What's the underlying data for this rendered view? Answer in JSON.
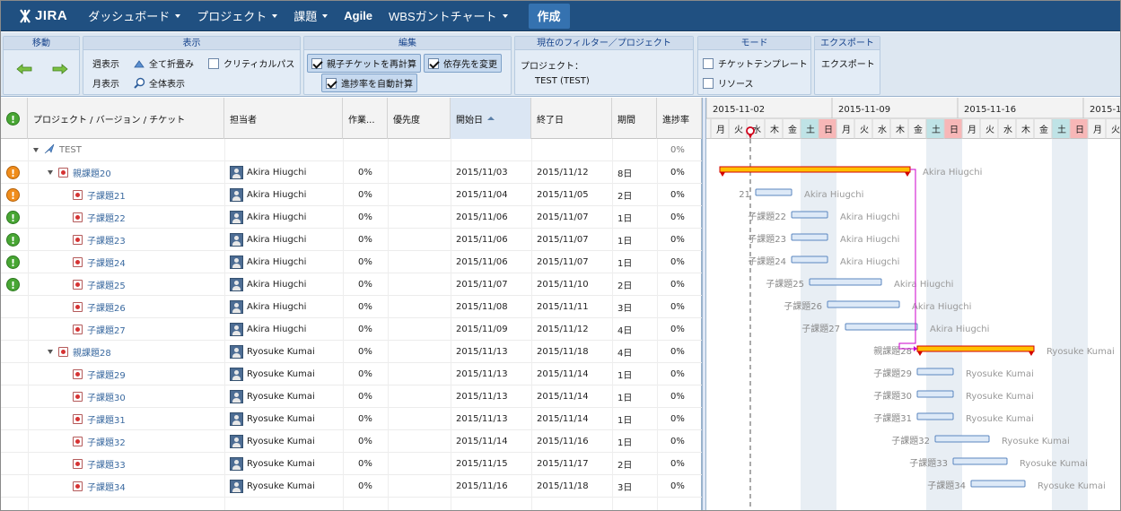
{
  "nav": {
    "logo": "JIRA",
    "items": [
      {
        "label": "ダッシュボード",
        "caret": true
      },
      {
        "label": "プロジェクト",
        "caret": true
      },
      {
        "label": "課題",
        "caret": true
      },
      {
        "label": "Agile",
        "caret": false
      },
      {
        "label": "WBSガントチャート",
        "caret": true
      }
    ],
    "create": "作成"
  },
  "toolbar": {
    "move": {
      "title": "移動"
    },
    "view": {
      "title": "表示",
      "week": "週表示",
      "month": "月表示",
      "collapse_all": "全て折畳み",
      "whole": "全体表示",
      "critical_path": "クリティカルパス"
    },
    "edit": {
      "title": "編集",
      "recalc_parent": "親子チケットを再計算",
      "change_dep": "依存先を変更",
      "auto_progress": "進捗率を自動計算"
    },
    "filter": {
      "title": "現在のフィルター／プロジェクト",
      "label": "プロジェクト：",
      "value": "TEST (TEST)"
    },
    "mode": {
      "title": "モード",
      "template": "チケットテンプレート",
      "resource": "リソース"
    },
    "export": {
      "title": "エクスポート",
      "label": "エクスポート"
    }
  },
  "grid": {
    "columns": [
      "プロジェクト / バージョン / チケット",
      "担当者",
      "作業...",
      "優先度",
      "開始日",
      "終了日",
      "期間",
      "進捗率"
    ],
    "rows": [
      {
        "type": "project",
        "name": "TEST",
        "progress": "0%",
        "prio": ""
      },
      {
        "type": "parent",
        "name": "親課題20",
        "assignee": "Akira Hiugchi",
        "work": "0%",
        "start": "2015/11/03",
        "end": "2015/11/12",
        "duration": "8日",
        "progress": "0%",
        "prio": "orange"
      },
      {
        "type": "child",
        "name": "子課題21",
        "assignee": "Akira Hiugchi",
        "work": "0%",
        "start": "2015/11/04",
        "end": "2015/11/05",
        "duration": "2日",
        "progress": "0%",
        "prio": "orange"
      },
      {
        "type": "child",
        "name": "子課題22",
        "assignee": "Akira Hiugchi",
        "work": "0%",
        "start": "2015/11/06",
        "end": "2015/11/07",
        "duration": "1日",
        "progress": "0%",
        "prio": "green"
      },
      {
        "type": "child",
        "name": "子課題23",
        "assignee": "Akira Hiugchi",
        "work": "0%",
        "start": "2015/11/06",
        "end": "2015/11/07",
        "duration": "1日",
        "progress": "0%",
        "prio": "green"
      },
      {
        "type": "child",
        "name": "子課題24",
        "assignee": "Akira Hiugchi",
        "work": "0%",
        "start": "2015/11/06",
        "end": "2015/11/07",
        "duration": "1日",
        "progress": "0%",
        "prio": "green"
      },
      {
        "type": "child",
        "name": "子課題25",
        "assignee": "Akira Hiugchi",
        "work": "0%",
        "start": "2015/11/07",
        "end": "2015/11/10",
        "duration": "2日",
        "progress": "0%",
        "prio": "green"
      },
      {
        "type": "child",
        "name": "子課題26",
        "assignee": "Akira Hiugchi",
        "work": "0%",
        "start": "2015/11/08",
        "end": "2015/11/11",
        "duration": "3日",
        "progress": "0%",
        "prio": ""
      },
      {
        "type": "child",
        "name": "子課題27",
        "assignee": "Akira Hiugchi",
        "work": "0%",
        "start": "2015/11/09",
        "end": "2015/11/12",
        "duration": "4日",
        "progress": "0%",
        "prio": ""
      },
      {
        "type": "parent",
        "name": "親課題28",
        "assignee": "Ryosuke Kumai",
        "work": "0%",
        "start": "2015/11/13",
        "end": "2015/11/18",
        "duration": "4日",
        "progress": "0%",
        "prio": ""
      },
      {
        "type": "child",
        "name": "子課題29",
        "assignee": "Ryosuke Kumai",
        "work": "0%",
        "start": "2015/11/13",
        "end": "2015/11/14",
        "duration": "1日",
        "progress": "0%",
        "prio": ""
      },
      {
        "type": "child",
        "name": "子課題30",
        "assignee": "Ryosuke Kumai",
        "work": "0%",
        "start": "2015/11/13",
        "end": "2015/11/14",
        "duration": "1日",
        "progress": "0%",
        "prio": ""
      },
      {
        "type": "child",
        "name": "子課題31",
        "assignee": "Ryosuke Kumai",
        "work": "0%",
        "start": "2015/11/13",
        "end": "2015/11/14",
        "duration": "1日",
        "progress": "0%",
        "prio": ""
      },
      {
        "type": "child",
        "name": "子課題32",
        "assignee": "Ryosuke Kumai",
        "work": "0%",
        "start": "2015/11/14",
        "end": "2015/11/16",
        "duration": "1日",
        "progress": "0%",
        "prio": ""
      },
      {
        "type": "child",
        "name": "子課題33",
        "assignee": "Ryosuke Kumai",
        "work": "0%",
        "start": "2015/11/15",
        "end": "2015/11/17",
        "duration": "2日",
        "progress": "0%",
        "prio": ""
      },
      {
        "type": "child",
        "name": "子課題34",
        "assignee": "Ryosuke Kumai",
        "work": "0%",
        "start": "2015/11/16",
        "end": "2015/11/18",
        "duration": "3日",
        "progress": "0%",
        "prio": ""
      }
    ]
  },
  "gantt": {
    "weeks": [
      "2015-11-02",
      "2015-11-09",
      "2015-11-16",
      "2015-1"
    ],
    "days": [
      "月",
      "火",
      "水",
      "木",
      "金",
      "土",
      "日",
      "月",
      "火",
      "水",
      "木",
      "金",
      "土",
      "日",
      "月",
      "火",
      "水",
      "木",
      "金",
      "土",
      "日",
      "月",
      "火"
    ],
    "bars": [
      null,
      {
        "startDay": 0.0,
        "len": 10.6,
        "kind": "parent",
        "label": "",
        "assignee": "Akira Hiugchi"
      },
      {
        "startDay": 2.0,
        "len": 2.0,
        "kind": "task",
        "label": "21",
        "assignee": "Akira Hiugchi"
      },
      {
        "startDay": 4.0,
        "len": 2.0,
        "kind": "task",
        "label": "子課題22",
        "assignee": "Akira Hiugchi"
      },
      {
        "startDay": 4.0,
        "len": 2.0,
        "kind": "task",
        "label": "子課題23",
        "assignee": "Akira Hiugchi"
      },
      {
        "startDay": 4.0,
        "len": 2.0,
        "kind": "task",
        "label": "子課題24",
        "assignee": "Akira Hiugchi"
      },
      {
        "startDay": 5.0,
        "len": 4.0,
        "kind": "task",
        "label": "子課題25",
        "assignee": "Akira Hiugchi"
      },
      {
        "startDay": 6.0,
        "len": 4.0,
        "kind": "task",
        "label": "子課題26",
        "assignee": "Akira Hiugchi"
      },
      {
        "startDay": 7.0,
        "len": 4.0,
        "kind": "task",
        "label": "子課題27",
        "assignee": "Akira Hiugchi"
      },
      {
        "startDay": 11.0,
        "len": 6.5,
        "kind": "parent",
        "label": "親課題28",
        "assignee": "Ryosuke Kumai"
      },
      {
        "startDay": 11.0,
        "len": 2.0,
        "kind": "task",
        "label": "子課題29",
        "assignee": "Ryosuke Kumai"
      },
      {
        "startDay": 11.0,
        "len": 2.0,
        "kind": "task",
        "label": "子課題30",
        "assignee": "Ryosuke Kumai"
      },
      {
        "startDay": 11.0,
        "len": 2.0,
        "kind": "task",
        "label": "子課題31",
        "assignee": "Ryosuke Kumai"
      },
      {
        "startDay": 12.0,
        "len": 3.0,
        "kind": "task",
        "label": "子課題32",
        "assignee": "Ryosuke Kumai"
      },
      {
        "startDay": 13.0,
        "len": 3.0,
        "kind": "task",
        "label": "子課題33",
        "assignee": "Ryosuke Kumai"
      },
      {
        "startDay": 14.0,
        "len": 3.0,
        "kind": "task",
        "label": "子課題34",
        "assignee": "Ryosuke Kumai"
      }
    ],
    "today_day": 1.9,
    "colors": {
      "parent": "#ffc000",
      "parent_border": "#d30000",
      "task": "#dde9f7",
      "task_border": "#5a86bf",
      "weekend": "#e8eef4",
      "sunday_head": "#f7b7b7",
      "saturday_head": "#bfe3e6",
      "dependency": "#cc00cc",
      "today": "#d0021b"
    }
  }
}
